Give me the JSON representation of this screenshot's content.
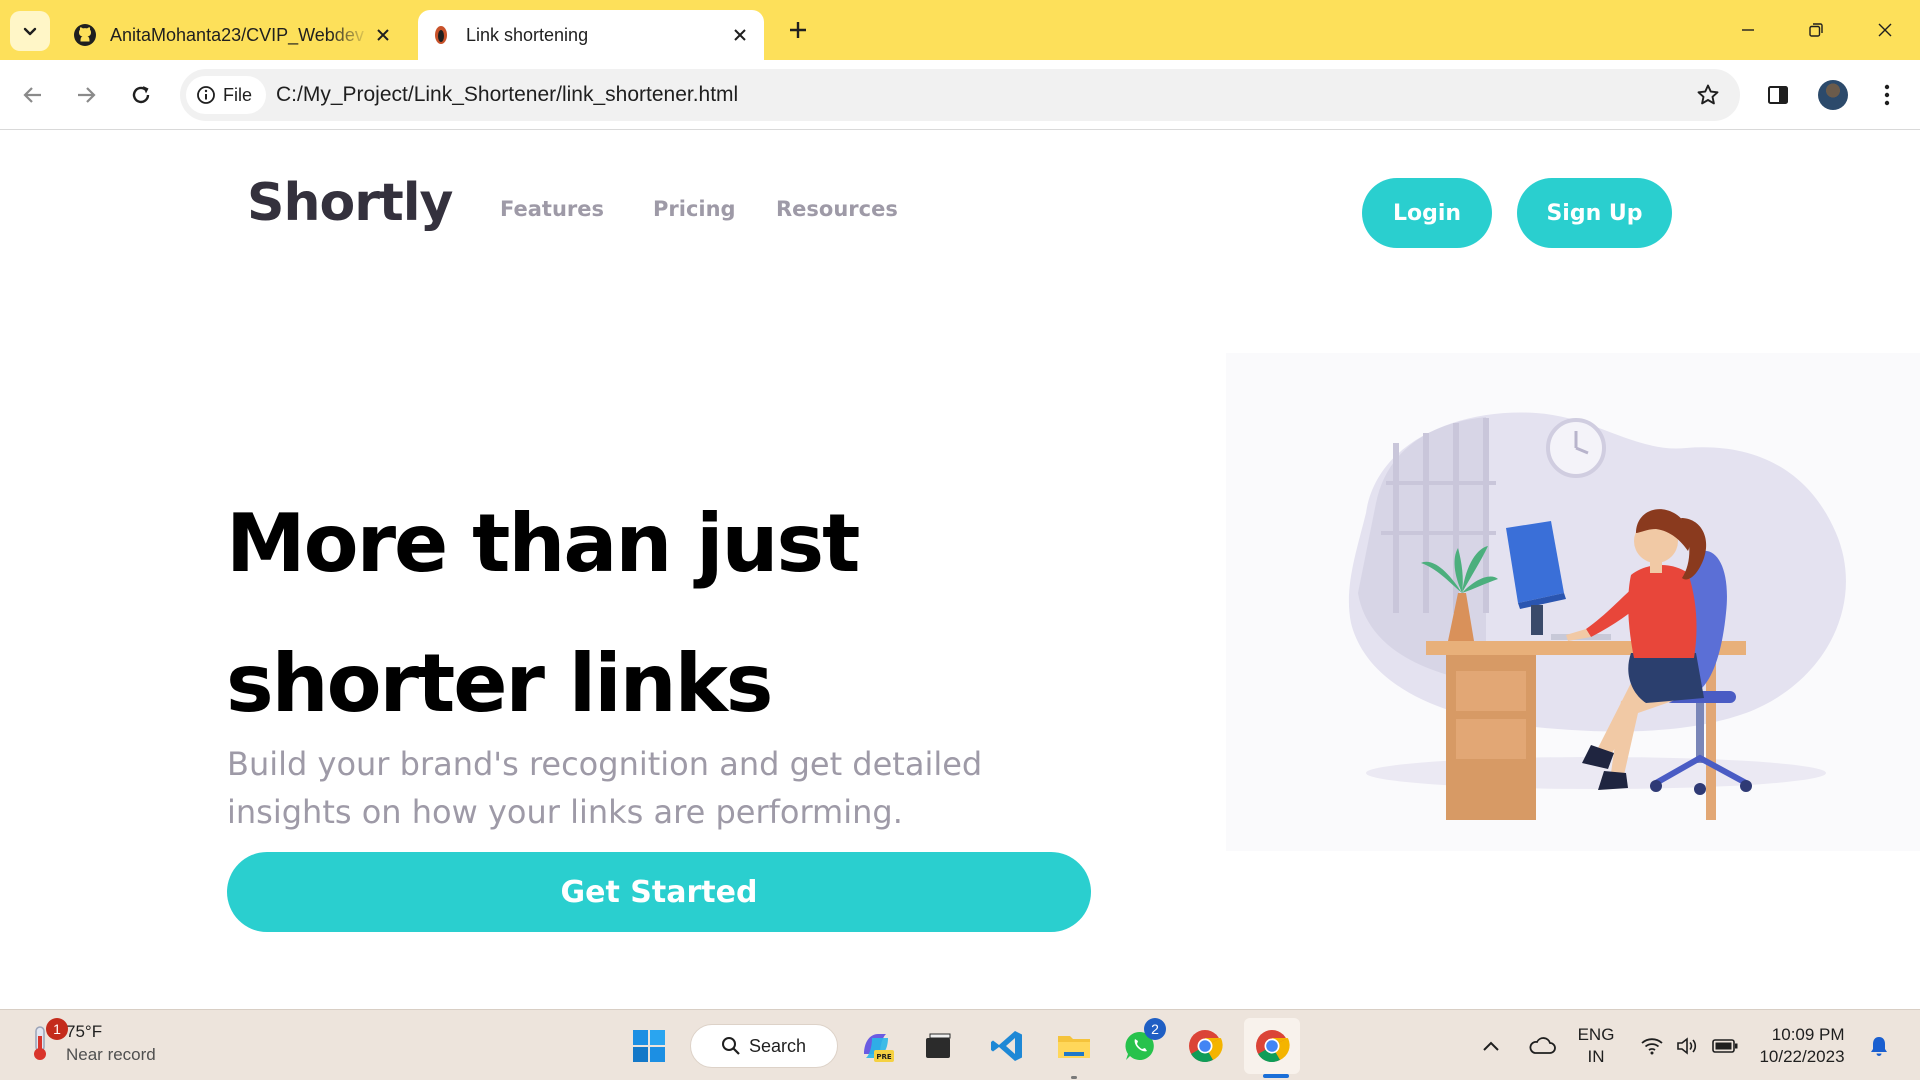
{
  "browser": {
    "tabs": [
      {
        "title": "AnitaMohanta23/CVIP_Webdev",
        "icon": "github-icon",
        "active": false
      },
      {
        "title": "Link shortening",
        "icon": "page-favicon",
        "active": true
      }
    ],
    "address_chip": "File",
    "url": "C:/My_Project/Link_Shortener/link_shortener.html",
    "colors": {
      "frame": "#fde05a",
      "omnibox": "#f1f1f1"
    }
  },
  "site": {
    "logo": "Shortly",
    "nav": [
      "Features",
      "Pricing",
      "Resources"
    ],
    "login_label": "Login",
    "signup_label": "Sign Up",
    "hero_title_line1": "More than just",
    "hero_title_line2": "shorter links",
    "hero_subtitle": "Build your brand's recognition and get detailed insights on how your links are performing.",
    "cta_label": "Get Started",
    "illustration": "woman-working-at-desk-illustration",
    "colors": {
      "accent": "#2acfcf",
      "text_dark": "#34313d",
      "text_muted": "#9e9aa7"
    }
  },
  "taskbar": {
    "weather_temp": "75°F",
    "weather_desc": "Near record",
    "weather_badge": "1",
    "search_label": "Search",
    "whatsapp_badge": "2",
    "language_line1": "ENG",
    "language_line2": "IN",
    "time": "10:09 PM",
    "date": "10/22/2023"
  }
}
